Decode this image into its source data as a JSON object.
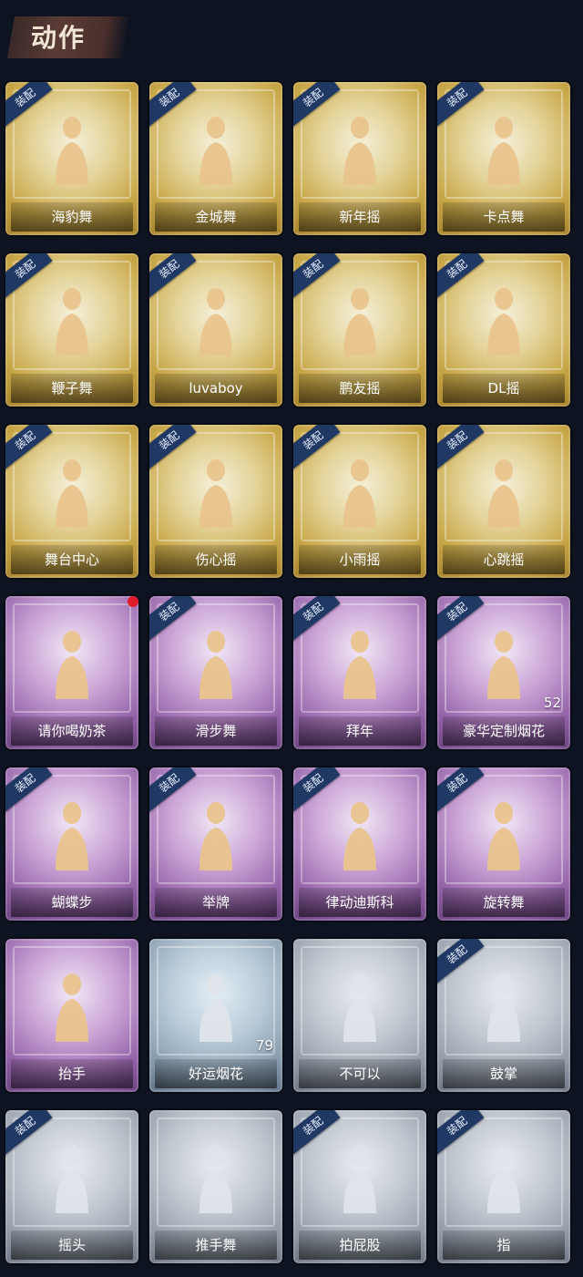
{
  "header": {
    "title": "动作"
  },
  "colors": {
    "gold": "#c9a84a",
    "purple": "#9463a8",
    "silver": "#8f98a5",
    "blue": "#8397aa",
    "ribbon": "#1f3864",
    "dot": "#e01c2a"
  },
  "tag_label": "装配",
  "cards": [
    {
      "label": "海豹舞",
      "rarity": "gold",
      "equipped": true
    },
    {
      "label": "金城舞",
      "rarity": "gold",
      "equipped": true
    },
    {
      "label": "新年摇",
      "rarity": "gold",
      "equipped": true
    },
    {
      "label": "卡点舞",
      "rarity": "gold",
      "equipped": true
    },
    {
      "label": "鞭子舞",
      "rarity": "gold",
      "equipped": true
    },
    {
      "label": "luvaboy",
      "rarity": "gold",
      "equipped": true
    },
    {
      "label": "鹏友摇",
      "rarity": "gold",
      "equipped": true
    },
    {
      "label": "DL摇",
      "rarity": "gold",
      "equipped": true
    },
    {
      "label": "舞台中心",
      "rarity": "gold",
      "equipped": true
    },
    {
      "label": "伤心摇",
      "rarity": "gold",
      "equipped": true
    },
    {
      "label": "小雨摇",
      "rarity": "gold",
      "equipped": true
    },
    {
      "label": "心跳摇",
      "rarity": "gold",
      "equipped": true
    },
    {
      "label": "请你喝奶茶",
      "rarity": "purple",
      "equipped": false,
      "new": true
    },
    {
      "label": "滑步舞",
      "rarity": "purple",
      "equipped": true
    },
    {
      "label": "拜年",
      "rarity": "purple",
      "equipped": true
    },
    {
      "label": "豪华定制烟花",
      "rarity": "purple",
      "equipped": true,
      "count": "52"
    },
    {
      "label": "蝴蝶步",
      "rarity": "purple",
      "equipped": true
    },
    {
      "label": "举牌",
      "rarity": "purple",
      "equipped": true
    },
    {
      "label": "律动迪斯科",
      "rarity": "purple",
      "equipped": true
    },
    {
      "label": "旋转舞",
      "rarity": "purple",
      "equipped": true
    },
    {
      "label": "抬手",
      "rarity": "purple",
      "equipped": false
    },
    {
      "label": "好运烟花",
      "rarity": "blue",
      "equipped": false,
      "count": "79"
    },
    {
      "label": "不可以",
      "rarity": "silver",
      "equipped": false
    },
    {
      "label": "鼓掌",
      "rarity": "silver",
      "equipped": true
    },
    {
      "label": "摇头",
      "rarity": "silver",
      "equipped": true
    },
    {
      "label": "推手舞",
      "rarity": "silver",
      "equipped": false
    },
    {
      "label": "拍屁股",
      "rarity": "silver",
      "equipped": true
    },
    {
      "label": "指",
      "rarity": "silver",
      "equipped": true
    }
  ]
}
